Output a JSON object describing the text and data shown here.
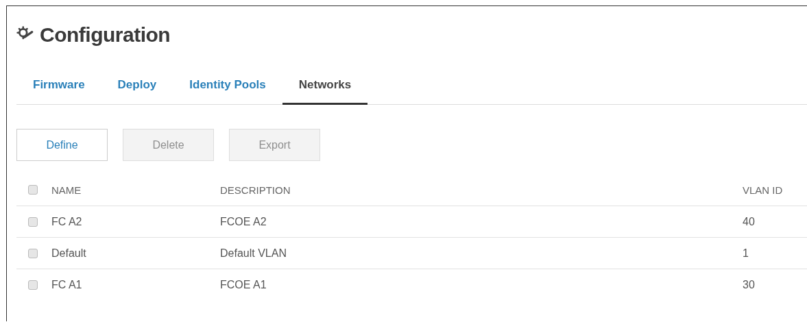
{
  "header": {
    "title": "Configuration"
  },
  "tabs": [
    {
      "label": "Firmware",
      "selected": false
    },
    {
      "label": "Deploy",
      "selected": false
    },
    {
      "label": "Identity Pools",
      "selected": false
    },
    {
      "label": "Networks",
      "selected": true
    }
  ],
  "toolbar": [
    {
      "label": "Define",
      "disabled": false
    },
    {
      "label": "Delete",
      "disabled": true
    },
    {
      "label": "Export",
      "disabled": true
    }
  ],
  "table": {
    "select_all_checked": false,
    "columns": [
      "NAME",
      "DESCRIPTION",
      "VLAN ID"
    ],
    "rows": [
      {
        "checked": false,
        "cells": [
          "FC A2",
          "FCOE A2",
          "40"
        ]
      },
      {
        "checked": false,
        "cells": [
          "Default",
          "Default VLAN",
          "1"
        ]
      },
      {
        "checked": false,
        "cells": [
          "FC A1",
          "FCOE A1",
          "30"
        ]
      }
    ]
  }
}
